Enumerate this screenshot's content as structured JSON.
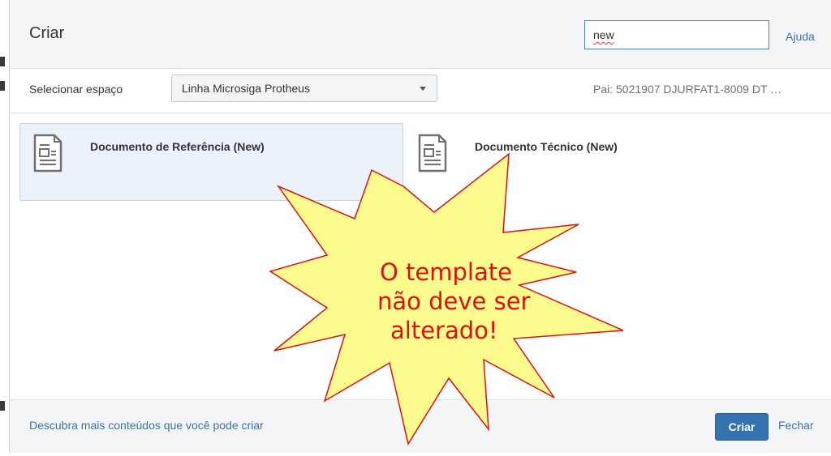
{
  "dialog": {
    "title": "Criar",
    "search": {
      "value": "new"
    },
    "help_label": "Ajuda"
  },
  "space_row": {
    "label": "Selecionar espaço",
    "selected_space": "Linha Microsiga Protheus",
    "parent_text": "Pai: 5021907 DJURFAT1-8009 DT …"
  },
  "templates": [
    {
      "title": "Documento de Referência (New)",
      "icon": "document-icon",
      "selected": true
    },
    {
      "title": "Documento Técnico (New)",
      "icon": "document-icon",
      "selected": false
    }
  ],
  "footer": {
    "discover_link": "Descubra mais conteúdos que você pode criar",
    "create_label": "Criar",
    "close_label": "Fechar"
  },
  "annotation": {
    "lines": [
      "O template",
      "não deve ser",
      "alterado!"
    ],
    "fill_color": "#fdfb8e",
    "stroke_color": "#e01010"
  }
}
